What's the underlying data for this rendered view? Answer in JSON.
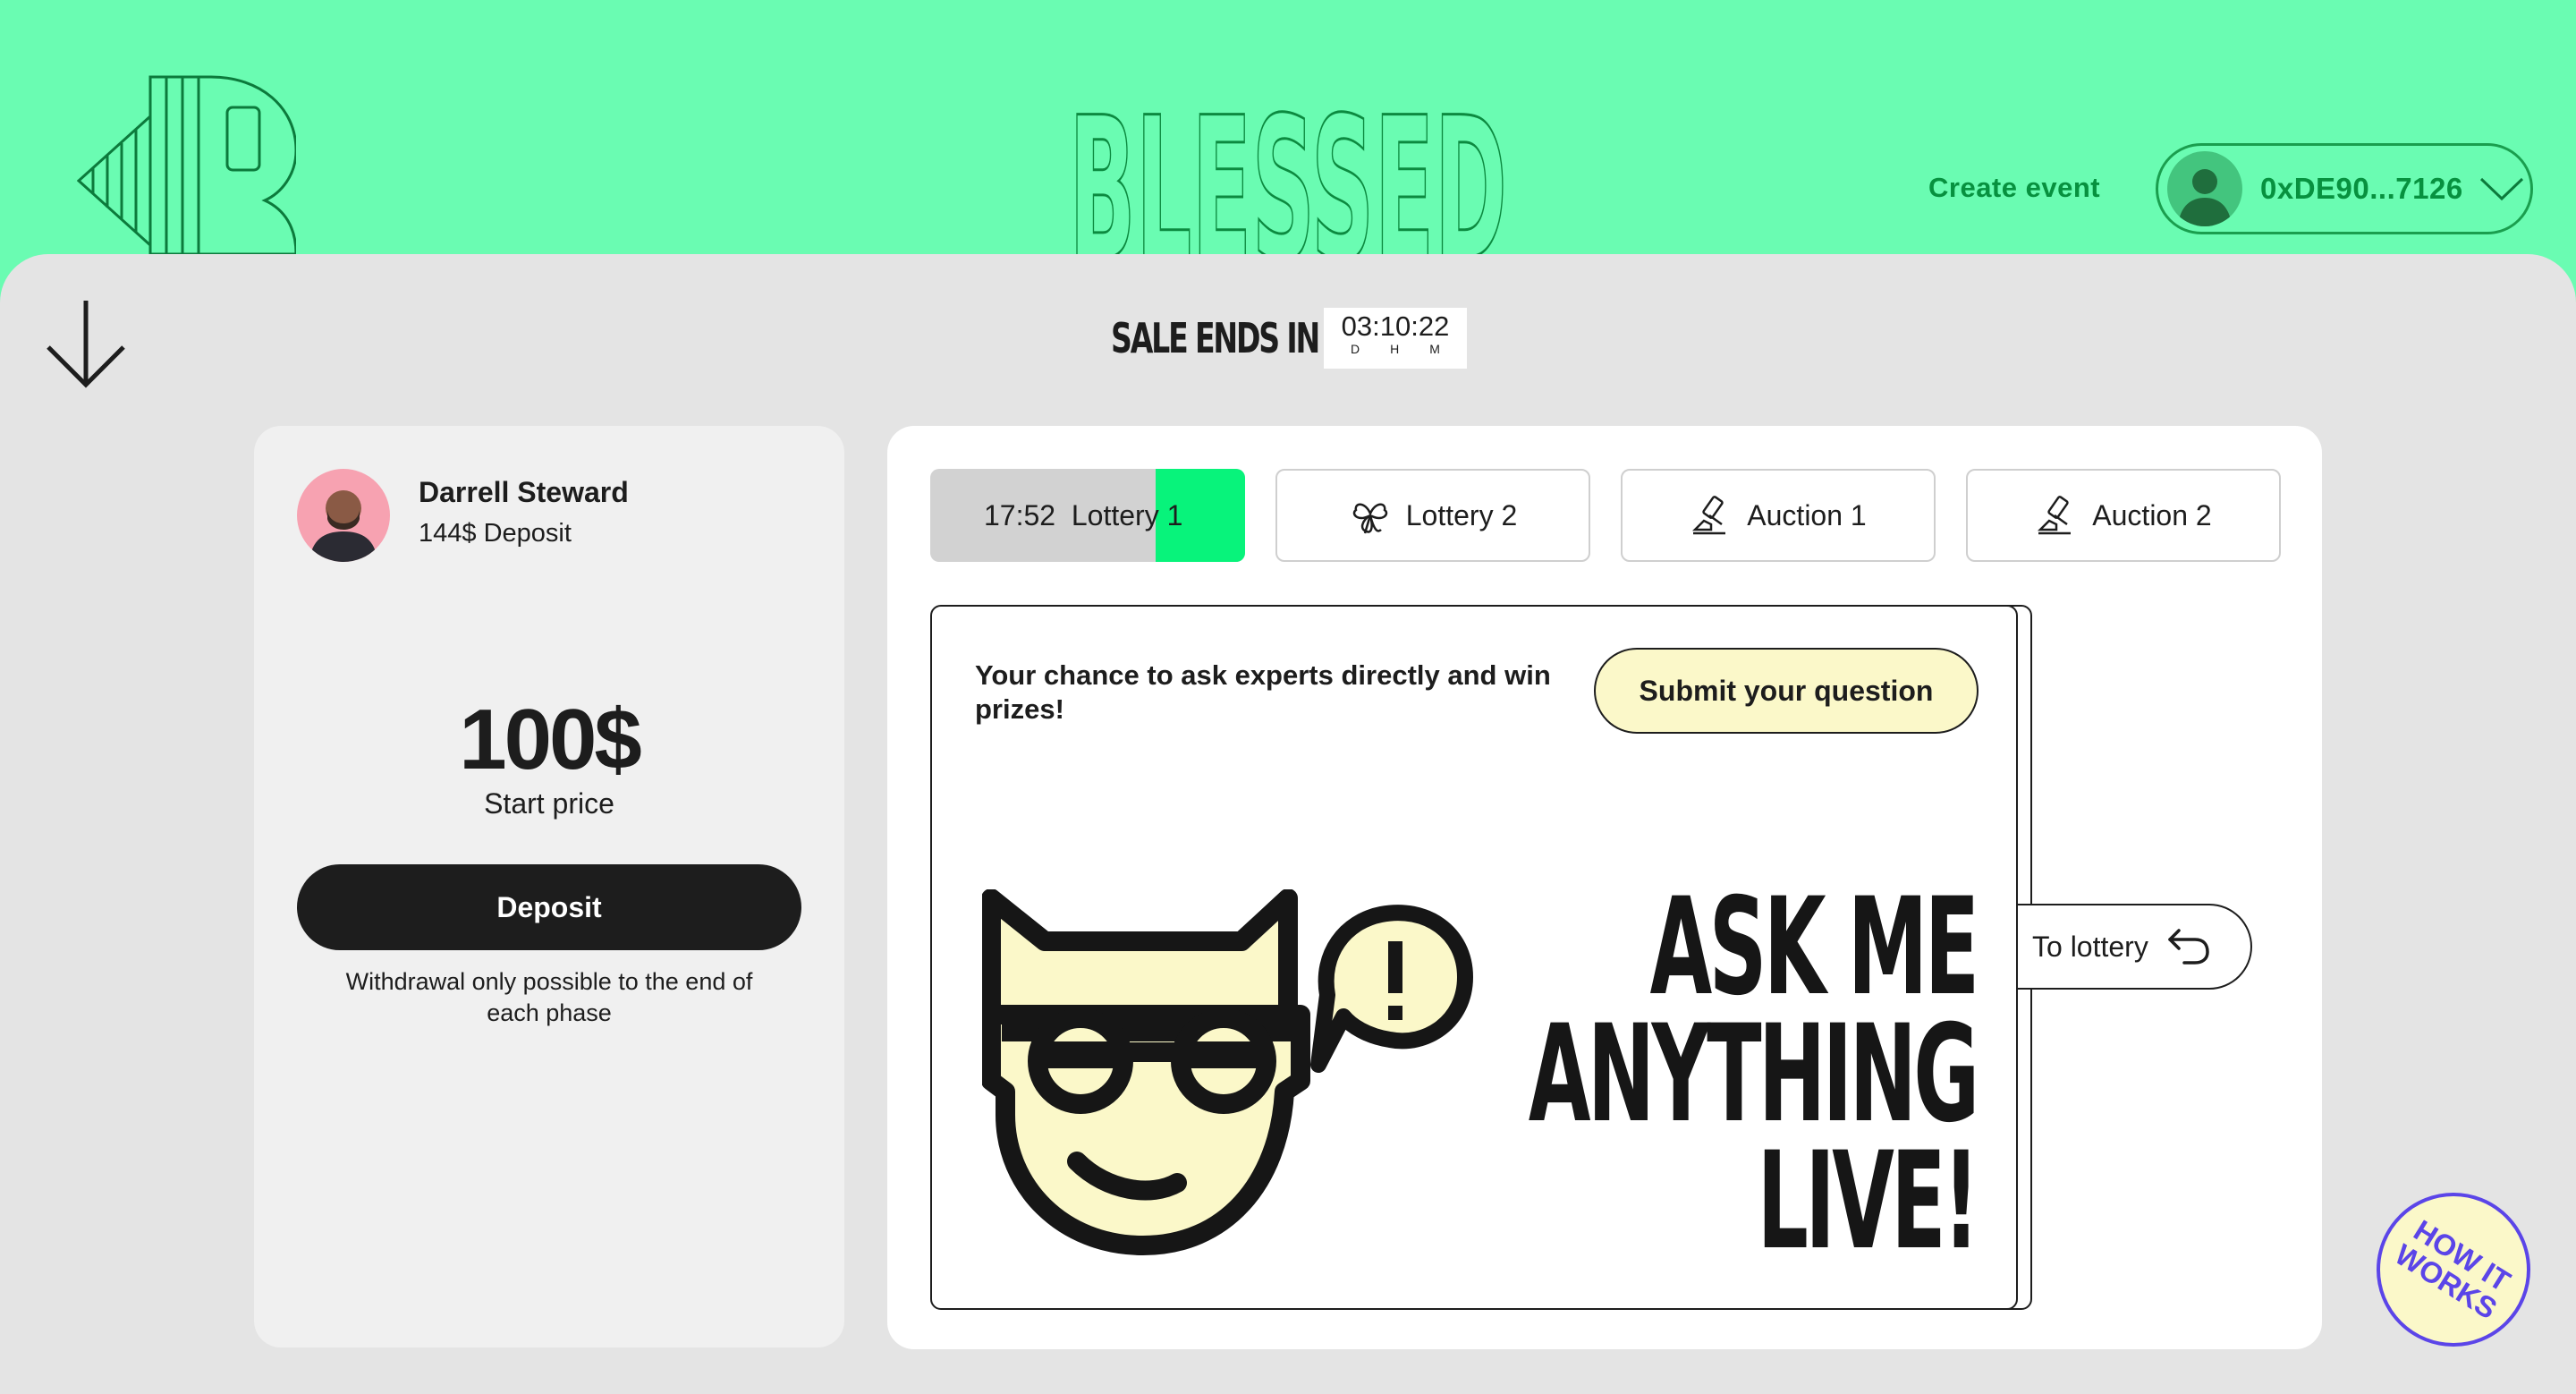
{
  "header": {
    "brand": "BLESSED",
    "create_event": "Create event",
    "wallet_address": "0xDE90...7126"
  },
  "sale": {
    "label": "SALE ENDS IN",
    "time": "03:10:22",
    "units": [
      "D",
      "H",
      "M"
    ]
  },
  "user": {
    "name": "Darrell Steward",
    "deposit": "144$ Deposit",
    "price": "100$",
    "price_label": "Start price",
    "deposit_button": "Deposit",
    "note": "Withdrawal only possible to the end of each phase"
  },
  "tabs": [
    {
      "label": "17:52  Lottery 1",
      "active": true,
      "progress": 0.28
    },
    {
      "label": "Lottery 2",
      "icon": "clover-icon"
    },
    {
      "label": "Auction 1",
      "icon": "gavel-icon"
    },
    {
      "label": "Auction 2",
      "icon": "gavel-icon"
    }
  ],
  "promo": {
    "text": "Your chance to ask experts directly and win prizes!",
    "submit_button": "Submit your question",
    "headline": [
      "ASK ME",
      "ANYTHING",
      "LIVE!"
    ]
  },
  "to_lottery": "To lottery",
  "how_it_works": "HOW IT WORKS",
  "colors": {
    "background": "#6afcb2",
    "accent_green": "#08f37b",
    "dark_green": "#07913f",
    "cream": "#fbf8c9",
    "purple": "#5b45e8"
  }
}
